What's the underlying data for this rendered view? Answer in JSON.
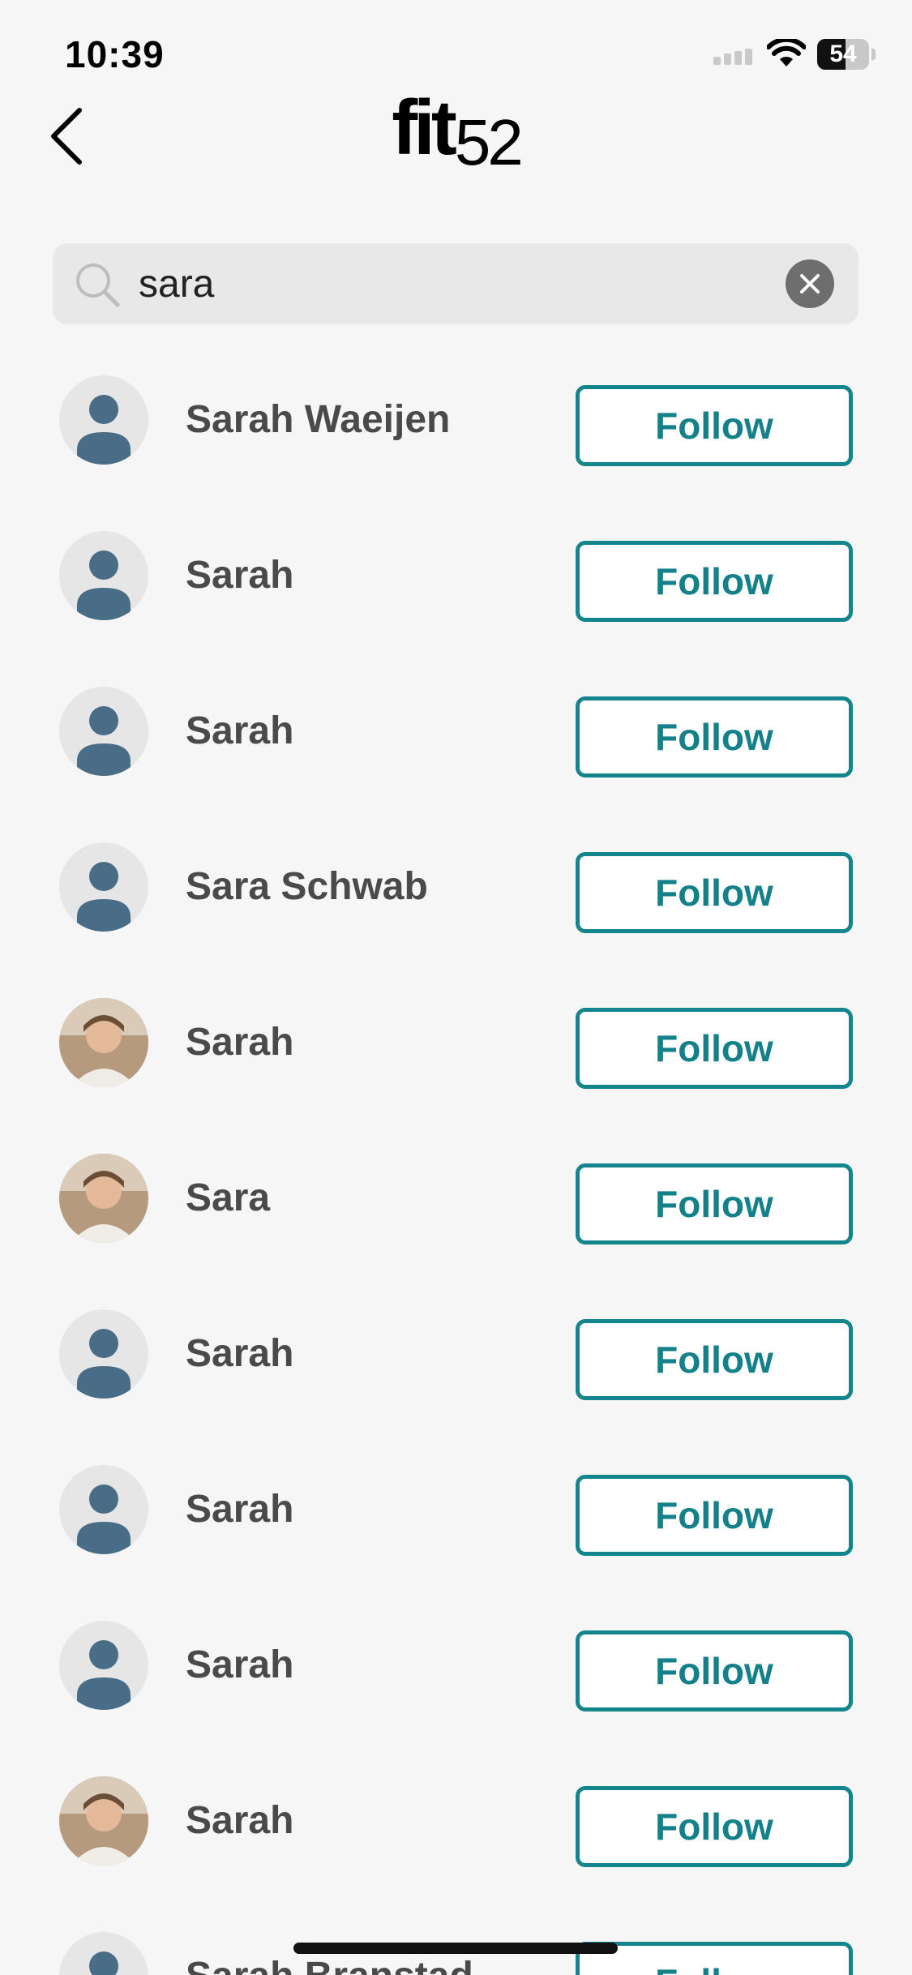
{
  "status_bar": {
    "time": "10:39",
    "battery": "54",
    "battery_level_percent": 54,
    "icons": [
      "cellular-signal-icon",
      "wifi-icon",
      "battery-icon"
    ]
  },
  "header": {
    "logo_word": "fit",
    "logo_number": "52",
    "back_icon": "chevron-left-icon"
  },
  "search": {
    "value": "sara",
    "icon": "search-icon",
    "clear_icon": "close-icon"
  },
  "results": [
    {
      "name": "Sarah Waeijen",
      "button": "Follow",
      "avatar": "placeholder"
    },
    {
      "name": "Sarah",
      "button": "Follow",
      "avatar": "placeholder"
    },
    {
      "name": "Sarah",
      "button": "Follow",
      "avatar": "placeholder"
    },
    {
      "name": "Sara Schwab",
      "button": "Follow",
      "avatar": "placeholder"
    },
    {
      "name": "Sarah",
      "button": "Follow",
      "avatar": "photo"
    },
    {
      "name": "Sara",
      "button": "Follow",
      "avatar": "photo"
    },
    {
      "name": "Sarah",
      "button": "Follow",
      "avatar": "placeholder"
    },
    {
      "name": "Sarah",
      "button": "Follow",
      "avatar": "placeholder"
    },
    {
      "name": "Sarah",
      "button": "Follow",
      "avatar": "placeholder"
    },
    {
      "name": "Sarah",
      "button": "Follow",
      "avatar": "photo"
    },
    {
      "name": "Sarah Branstad",
      "button": "Follow",
      "avatar": "placeholder"
    }
  ],
  "colors": {
    "accent": "#14858d",
    "name_text": "#4a4a4a",
    "placeholder_avatar": "#4a6d87",
    "background": "#f6f6f6"
  }
}
